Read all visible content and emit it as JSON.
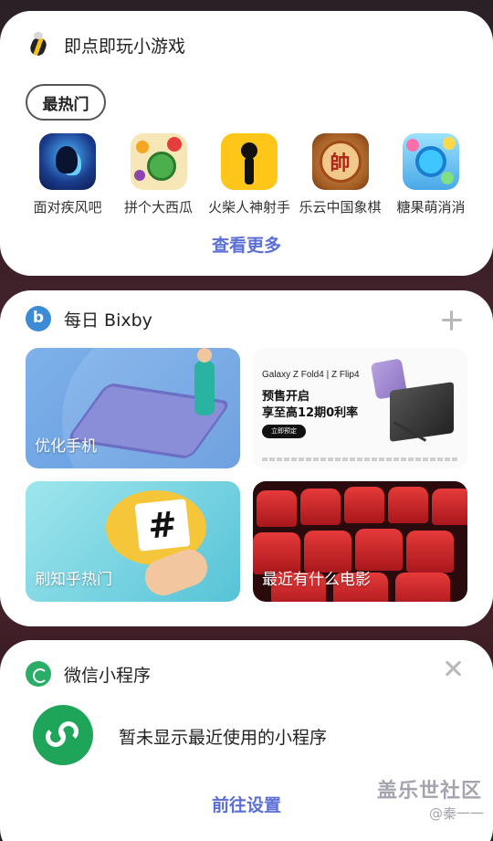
{
  "games_card": {
    "title": "即点即玩小游戏",
    "filter_label": "最热门",
    "games": [
      {
        "name": "面对疾风吧",
        "icon": "ninja-game-icon"
      },
      {
        "name": "拼个大西瓜",
        "icon": "watermelon-game-icon"
      },
      {
        "name": "火柴人神射手",
        "icon": "stickman-game-icon"
      },
      {
        "name": "乐云中国象棋",
        "icon": "chinese-chess-icon"
      },
      {
        "name": "糖果萌消消",
        "icon": "candy-game-icon"
      }
    ],
    "see_more": "查看更多",
    "chess_glyph": "帥"
  },
  "bixby_card": {
    "title": "每日 Bixby",
    "tiles": {
      "optimize": "优化手机",
      "ad": {
        "brand": "Galaxy Z Fold4 | Z Flip4",
        "line1": "预售开启",
        "line2": "享至高12期0利率",
        "button": "立即预定"
      },
      "zhihu": "刷知乎热门",
      "movie": "最近有什么电影"
    },
    "zhihu_glyph": "#"
  },
  "wechat_card": {
    "title": "微信小程序",
    "empty_text": "暂未显示最近使用的小程序",
    "goto_settings": "前往设置"
  },
  "watermark": {
    "main": "盖乐世社区",
    "sub": "@秦一一"
  },
  "colors": {
    "accent": "#5b6fd6",
    "wechat_green": "#1fa55a",
    "bixby_blue": "#3b8bd6"
  }
}
